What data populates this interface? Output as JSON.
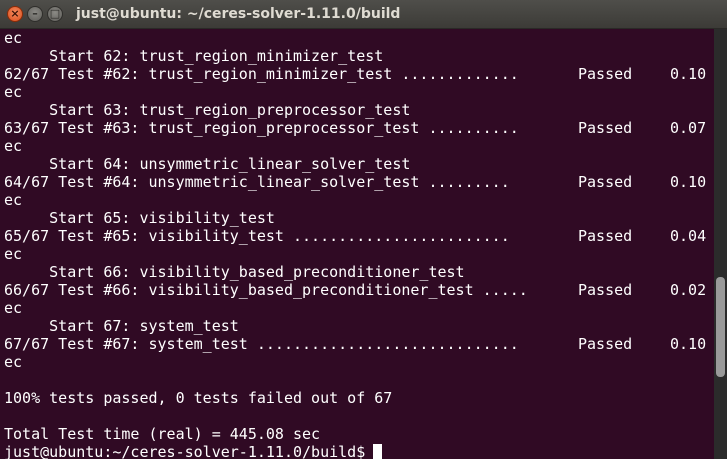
{
  "window": {
    "title": "just@ubuntu: ~/ceres-solver-1.11.0/build",
    "close_glyph": "×",
    "minimize_glyph": "–",
    "maximize_glyph": "□"
  },
  "terminal": {
    "top_fragment": "ec",
    "tests": [
      {
        "start_line": "     Start 62: trust_region_minimizer_test",
        "result_line": "62/67 Test #62: trust_region_minimizer_test .............",
        "status": "Passed",
        "time": "0.10 s",
        "wrap": "ec"
      },
      {
        "start_line": "     Start 63: trust_region_preprocessor_test",
        "result_line": "63/67 Test #63: trust_region_preprocessor_test ..........",
        "status": "Passed",
        "time": "0.07 s",
        "wrap": "ec"
      },
      {
        "start_line": "     Start 64: unsymmetric_linear_solver_test",
        "result_line": "64/67 Test #64: unsymmetric_linear_solver_test .........",
        "status": "Passed",
        "time": "0.10 s",
        "wrap": "ec"
      },
      {
        "start_line": "     Start 65: visibility_test",
        "result_line": "65/67 Test #65: visibility_test ........................",
        "status": "Passed",
        "time": "0.04 s",
        "wrap": "ec"
      },
      {
        "start_line": "     Start 66: visibility_based_preconditioner_test",
        "result_line": "66/67 Test #66: visibility_based_preconditioner_test .....",
        "status": "Passed",
        "time": "0.02 s",
        "wrap": "ec"
      },
      {
        "start_line": "     Start 67: system_test",
        "result_line": "67/67 Test #67: system_test .............................",
        "status": "Passed",
        "time": "0.10 s",
        "wrap": "ec"
      }
    ],
    "summary": "100% tests passed, 0 tests failed out of 67",
    "total_time": "Total Test time (real) = 445.08 sec",
    "prompt": "just@ubuntu:~/ceres-solver-1.11.0/build$ "
  }
}
